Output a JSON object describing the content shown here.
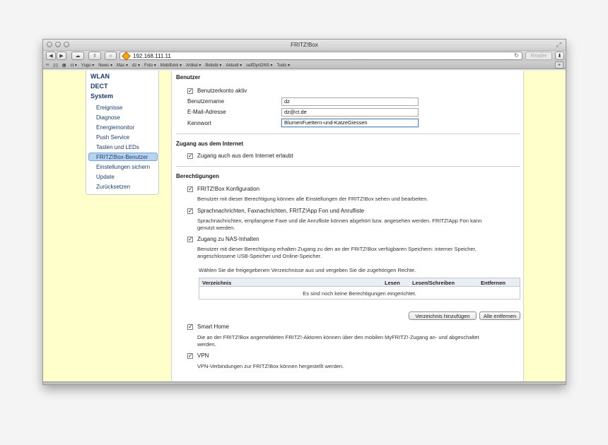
{
  "window": {
    "title": "FRITZ!Box"
  },
  "toolbar": {
    "url": "192.168.111.11",
    "reader": "Reader"
  },
  "bookmarks": [
    "ct ▾",
    "Yugo ▾",
    "News ▾",
    "Mac ▾",
    "dz ▾",
    "Foto ▾",
    "Mobilfunk ▾",
    "Artikel ▾",
    "Beliebt ▾",
    "Aktuell ▾",
    "selfDynDNS ▾",
    "Tools ▾"
  ],
  "sidebar": {
    "top_items": [
      "WLAN",
      "DECT",
      "System"
    ],
    "sub_items": [
      "Ereignisse",
      "Diagnose",
      "Energiemonitor",
      "Push Service",
      "Tasten und LEDs",
      "FRITZ!Box-Benutzer",
      "Einstellungen sichern",
      "Update",
      "Zurücksetzen"
    ],
    "selected": "FRITZ!Box-Benutzer"
  },
  "benutzer": {
    "heading": "Benutzer",
    "account_active": "Benutzerkonto aktiv",
    "username_label": "Benutzername",
    "username_value": "dz",
    "email_label": "E-Mail-Adresse",
    "email_value": "dz@ct.de",
    "password_label": "Kennwort",
    "password_value": "BlumenFuettern-und-KatzeGiessen"
  },
  "internet": {
    "heading": "Zugang aus dem Internet",
    "allow": "Zugang auch aus dem Internet erlaubt"
  },
  "rights": {
    "heading": "Berechtigungen",
    "config_label": "FRITZ!Box Konfiguration",
    "config_desc": "Benutzer mit dieser Berechtigung können alle Einstellungen der FRITZ!Box sehen und bearbeiten.",
    "voice_label": "Sprachnachrichten, Faxnachrichten, FRITZ!App Fon und Anrufliste",
    "voice_desc1": "Sprachnachrichten, empfangene Faxe und die Anrufliste können abgehört bzw. angesehen werden. FRITZ!App Fon kann",
    "voice_desc2": "genutzt werden.",
    "nas_label": "Zugang zu NAS-Inhalten",
    "nas_desc1": "Benutzer mit dieser Berechtigung erhalten Zugang zu den an der FRITZ!Box verfügbaren Speichern: interner Speicher,",
    "nas_desc2": "angeschlossene USB-Speicher und Online-Speicher.",
    "nas_hint": "Wählen Sie die freigegebenen Verzeichnisse aus und vergeben Sie die zugehörigen Rechte.",
    "table": {
      "col_dir": "Verzeichnis",
      "col_read": "Lesen",
      "col_rw": "Lesen/Schreiben",
      "col_remove": "Entfernen",
      "empty": "Es sind noch keine Berechtigungen eingerichtet."
    },
    "add_dir_button": "Verzeichnis hinzufügen",
    "remove_all_button": "Alle entfernen",
    "smarthome_label": "Smart Home",
    "smarthome_desc1": "Die an der FRITZ!Box angemeldeten FRITZ!-Aktoren können über den mobilen MyFRITZ!-Zugang an- und abgeschaltet",
    "smarthome_desc2": "werden.",
    "vpn_label": "VPN",
    "vpn_desc": "VPN-Verbindungen zur FRITZ!Box können hergestellt werden."
  }
}
